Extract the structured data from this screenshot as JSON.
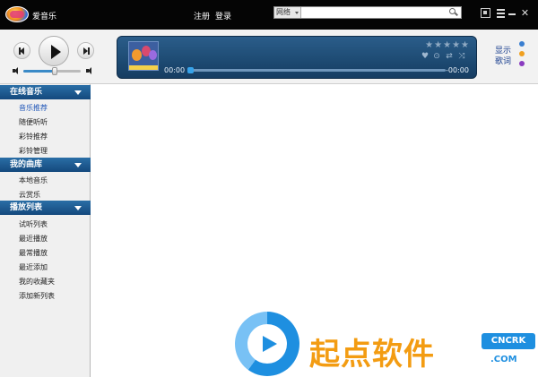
{
  "app": {
    "name": "爱音乐"
  },
  "header": {
    "register": "注册",
    "login": "登录",
    "search": {
      "scope": "网络",
      "placeholder": ""
    }
  },
  "player": {
    "time_current": "00:00",
    "time_total": "-00:00",
    "progress": 0,
    "volume": 0.55,
    "rating": 0,
    "rating_max": 5,
    "stars": "★★★★★",
    "show_label": "显示",
    "lyrics_label": "歌词",
    "dot_colors": [
      "#3a7fd0",
      "#f0a020",
      "#8a3cc0"
    ]
  },
  "sidebar": {
    "groups": [
      {
        "title": "在线音乐",
        "items": [
          "音乐推荐",
          "随便听听",
          "彩铃推荐",
          "彩铃管理"
        ]
      },
      {
        "title": "我的曲库",
        "items": [
          "本地音乐",
          "云赏乐"
        ]
      },
      {
        "title": "播放列表",
        "items": [
          "试听列表",
          "最近播放",
          "最常播放",
          "最近添加",
          "我的收藏夹",
          "添加新列表"
        ]
      }
    ],
    "active_item": "音乐推荐"
  },
  "watermark": {
    "brand": "起点软件",
    "badge": "CNCRK",
    "domain": ".COM"
  },
  "colors": {
    "titlebar": "#050505",
    "accent": "#1f56b8",
    "group_header": "#1d5a92"
  }
}
